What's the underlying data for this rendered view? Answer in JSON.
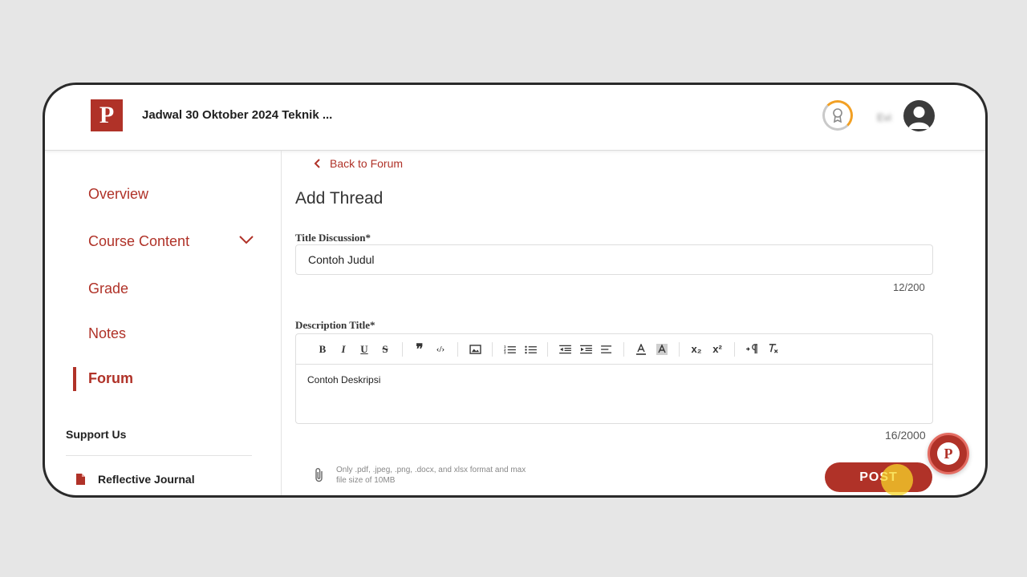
{
  "header": {
    "logo_letter": "P",
    "course_title": "Jadwal 30 Oktober 2024 Teknik ...",
    "user_name": "Evi"
  },
  "sidebar": {
    "items": [
      {
        "label": "Overview"
      },
      {
        "label": "Course Content"
      },
      {
        "label": "Grade"
      },
      {
        "label": "Notes"
      },
      {
        "label": "Forum"
      }
    ],
    "active_item": "Forum",
    "support_heading": "Support Us",
    "support_items": [
      {
        "label": "Reflective Journal"
      }
    ]
  },
  "main": {
    "back_label": "Back to Forum",
    "page_title": "Add Thread",
    "title_field": {
      "label": "Title Discussion*",
      "value": "Contoh Judul",
      "counter": "12/200"
    },
    "description_field": {
      "label": "Description Title*",
      "value": "Contoh Deskripsi",
      "counter": "16/2000"
    },
    "toolbar": {
      "bold": "B",
      "italic": "I",
      "underline": "U",
      "strike": "S",
      "quote": "❞",
      "code": "‹/›",
      "subscript": "x₂",
      "superscript": "x²"
    },
    "attachment_note": "Only .pdf, .jpeg, .png, .docx, and xlsx format and max file size of 10MB",
    "post_label": "POST"
  },
  "fab": {
    "letter": "P"
  },
  "colors": {
    "brand": "#b03228",
    "badge_ring": "#f2a024",
    "background": "#e6e6e6"
  }
}
